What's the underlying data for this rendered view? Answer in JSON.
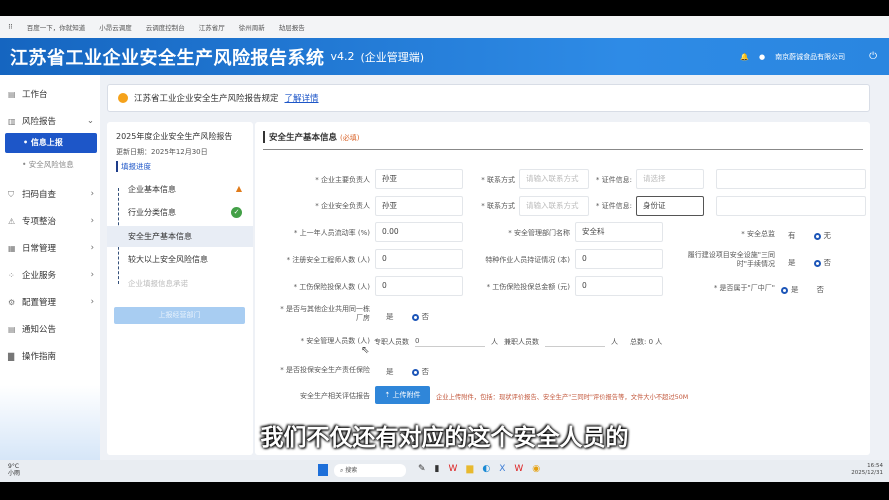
{
  "bookmarks": [
    "百度一下，你就知道",
    "小昂云调度",
    "云调度控制台",
    "江苏省厅",
    "徐州周新",
    "劫层报告"
  ],
  "header": {
    "title": "江苏省工业企业安全生产风险报告系统",
    "version": "v4.2",
    "edition": "(企业管理端)",
    "company": "南京蔚诚食品有限公司"
  },
  "sidebar": {
    "items": [
      {
        "label": "工作台",
        "icon": "dashboard-icon"
      },
      {
        "label": "风险报告",
        "icon": "report-icon",
        "sub": [
          "• 信息上报",
          "• 安全风险信息"
        ]
      },
      {
        "label": "扫码自查",
        "icon": "shield-icon"
      },
      {
        "label": "专项整治",
        "icon": "warning-icon"
      },
      {
        "label": "日常管理",
        "icon": "calendar-icon"
      },
      {
        "label": "企业服务",
        "icon": "grid-icon"
      },
      {
        "label": "配置管理",
        "icon": "gear-icon"
      },
      {
        "label": "通知公告",
        "icon": "notice-icon"
      },
      {
        "label": "操作指南",
        "icon": "book-icon"
      }
    ]
  },
  "notice": {
    "text": "江苏省工业企业安全生产风险报告规定",
    "link": "了解详情"
  },
  "progress": {
    "title": "2025年度企业安全生产风险报告",
    "date": "更新日期：2025年12月30日",
    "heading": "填报进度",
    "steps": [
      {
        "label": "企业基本信息",
        "status": "warning"
      },
      {
        "label": "行业分类信息",
        "status": "done"
      },
      {
        "label": "安全生产基本信息",
        "status": "active"
      },
      {
        "label": "较大以上安全风险信息",
        "status": "pending"
      },
      {
        "label": "企业填报信息承诺",
        "status": "disabled"
      }
    ],
    "submit": "上报经营部门"
  },
  "form": {
    "title": "安全生产基本信息",
    "required": "(必填)",
    "main_person_label": "* 企业主要负责人",
    "main_person": "孙亚",
    "safety_person_label": "* 企业安全负责人",
    "safety_person": "孙亚",
    "contact_label": "* 联系方式",
    "contact_ph": "请输入联系方式",
    "cert_label": "* 证件信息:",
    "cert_ph": "请选择",
    "cert_value": "身份证",
    "turnover_label": "* 上一年人员流动率 (%)",
    "turnover": "0.00",
    "dept_label": "* 安全管理部门名称",
    "dept": "安全科",
    "supervisor_label": "* 安全总监",
    "yes_has": "有",
    "no_has": "无",
    "engineers_label": "* 注册安全工程师人数 (人)",
    "engineers": "0",
    "special_label": "特种作业人员持证情况 (本)",
    "special": "0",
    "three_label": "履行建设项目安全设施\"三同时\"手续情况",
    "yes": "是",
    "no": "否",
    "injury_count_label": "* 工伤保险投保人数 (人)",
    "injury_count": "0",
    "injury_amount_label": "* 工伤保险投保总金额 (元)",
    "injury_amount": "0",
    "factory_label": "* 是否属于\"厂中厂\"",
    "shared_label": "* 是否与其他企业共用同一栋厂房",
    "staff_label": "* 安全管理人员数 (人)",
    "fulltime_label": "专职人员数",
    "fulltime": "0",
    "unit": "人",
    "parttime_label": "兼职人员数",
    "total": "总数: 0 人",
    "insurance_label": "* 是否投保安全生产责任保险",
    "report_label": "安全生产相关评估报告",
    "upload": "⇡ 上传附件",
    "upload_hint": "企业上传附件，包括：现状评价报告、安全生产\"三同时\"评价报告等，文件大小不超过50M"
  },
  "subtitle": "我们不仅还有对应的这个安全人员的",
  "taskbar": {
    "weather": "9°C",
    "weather2": "小雨",
    "search": "搜索",
    "time": "16:54",
    "date": "2025/12/31"
  }
}
